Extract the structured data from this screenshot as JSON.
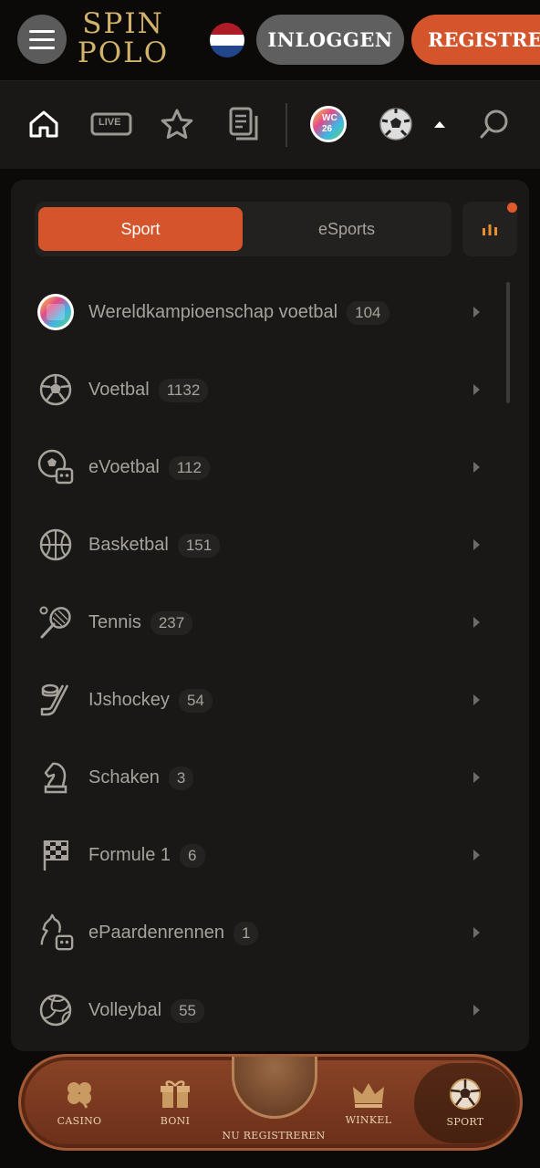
{
  "header": {
    "logo_line1": "SPIN",
    "logo_line2": "POLO",
    "login_label": "INLOGGEN",
    "register_label": "REGISTREREN",
    "flag_colors": [
      "#ae1c28",
      "#ffffff",
      "#21468b"
    ]
  },
  "nav": {
    "live_label": "LIVE",
    "wc_badge_line1": "WC",
    "wc_badge_line2": "26"
  },
  "tabs": {
    "sport_label": "Sport",
    "esports_label": "eSports"
  },
  "sports": [
    {
      "name": "Wereldkampioenschap voetbal",
      "count": "104",
      "icon": "wc26-icon"
    },
    {
      "name": "Voetbal",
      "count": "1132",
      "icon": "soccer-ball-icon"
    },
    {
      "name": "eVoetbal",
      "count": "112",
      "icon": "esoccer-icon"
    },
    {
      "name": "Basketbal",
      "count": "151",
      "icon": "basketball-icon"
    },
    {
      "name": "Tennis",
      "count": "237",
      "icon": "tennis-icon"
    },
    {
      "name": "IJshockey",
      "count": "54",
      "icon": "ice-hockey-icon"
    },
    {
      "name": "Schaken",
      "count": "3",
      "icon": "chess-knight-icon"
    },
    {
      "name": "Formule 1",
      "count": "6",
      "icon": "checkered-flag-icon"
    },
    {
      "name": "ePaardenrennen",
      "count": "1",
      "icon": "horse-racing-icon"
    },
    {
      "name": "Volleybal",
      "count": "55",
      "icon": "volleyball-icon"
    }
  ],
  "bottom_nav": {
    "casino": "CASINO",
    "boni": "BONI",
    "register": "NU REGISTREREN",
    "shop": "WINKEL",
    "sport": "SPORT"
  },
  "colors": {
    "accent": "#d4552b",
    "background": "#0b0a09",
    "panel": "#191817"
  }
}
